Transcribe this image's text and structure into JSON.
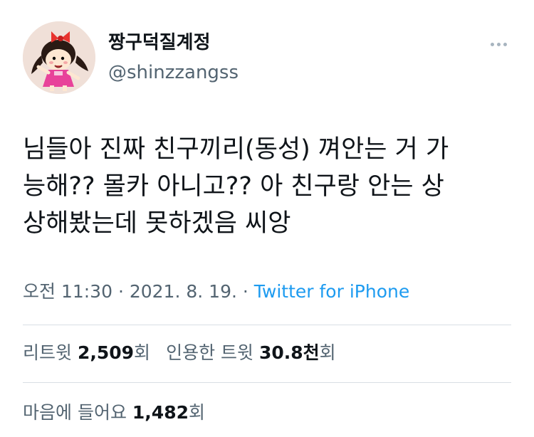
{
  "author": {
    "display_name": "짱구덕질계정",
    "handle": "@shinzzangss"
  },
  "tweet": {
    "lines": [
      "님들아 진짜 친구끼리(동성) 껴안는 거 가",
      "능해?? 몰카 아니고?? 아 친구랑 안는 상",
      "상해봤는데 못하겠음 씨앙"
    ]
  },
  "meta": {
    "time": "오전 11:30",
    "sep1": " · ",
    "date": "2021. 8. 19.",
    "sep2": " · ",
    "source": "Twitter for iPhone"
  },
  "stats": {
    "retweets_label": "리트윗",
    "retweets_count": "2,509",
    "retweets_unit": "회",
    "quotes_label": "인용한 트윗",
    "quotes_count": "30.8천",
    "quotes_unit": "회",
    "likes_label": "마음에 들어요",
    "likes_count": "1,482",
    "likes_unit": "회"
  },
  "colors": {
    "text": "#0f1419",
    "secondary": "#536471",
    "link": "#1d9bf0",
    "divider": "#d9dfe4"
  }
}
